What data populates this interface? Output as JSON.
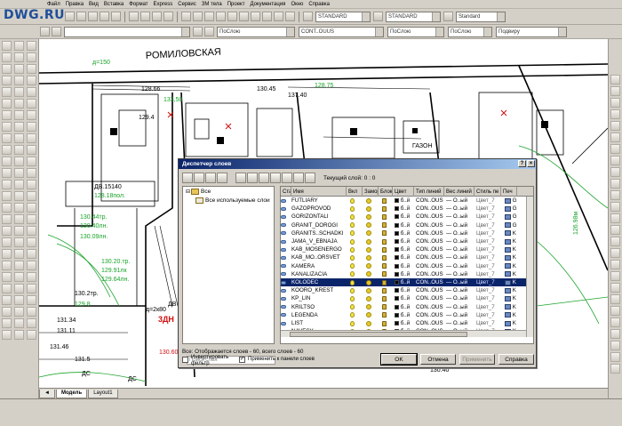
{
  "app": {
    "watermark": "DWG.RU",
    "menu": [
      "Файл",
      "Правка",
      "Вид",
      "Вставка",
      "Формат",
      "Express",
      "Сервис",
      "ЗМ тела",
      "Проект",
      "Документация",
      "Окно",
      "Справка"
    ],
    "toolbar": {
      "style1": "STANDARD",
      "style2": "STANDARD",
      "style3": "Standard",
      "layer_combo": "",
      "color_combo": "ПоСлою",
      "linetype_combo": "CONT..OUUS",
      "lineweight_combo": "ПоСлою",
      "plotstyle_combo": "ПоСлою",
      "plot_combo": "Подвиру"
    },
    "tabs": [
      "Модель",
      "Layout1"
    ],
    "tab_nav": "◄"
  },
  "drawing": {
    "street_label": "РОМИЛОВСКАЯ",
    "labels": [
      "д=150",
      "128.66",
      "133,50",
      "129.4",
      "130.45",
      "137.40",
      "128.75",
      "3ДН",
      "ДВ.15140",
      "128.18пол.",
      "130.44тр.",
      "130.40лн.",
      "130.09лн.",
      "130.20.тр.",
      "129.91лк",
      "129.64лн.",
      "130.2тр.",
      "129.8",
      "131.34",
      "131.11",
      "130.60",
      "д=2к80",
      "ДВ",
      "129.40",
      "130.20",
      "129.80",
      "ГАЗОН",
      "131.46",
      "131.5",
      "ДС",
      "ДС",
      "130.40",
      "137.10",
      "126.98м"
    ]
  },
  "dialog": {
    "title": "Диспетчер слоев",
    "current_layer": "Текущий слой: 0 : 0",
    "tree": {
      "root": "Все",
      "child": "Все используемые слои",
      "search_placeholder": "Поиск слоя"
    },
    "columns": [
      "Ста",
      "Имя",
      "Вкл",
      "Замор",
      "Блок",
      "Цвет",
      "Тип линий",
      "Вес линий",
      "Стиль пе",
      "Печ"
    ],
    "rows": [
      {
        "name": "FUTLIARY",
        "color": "б..й",
        "linetype": "CON..OUS",
        "lw": "— О..ый",
        "style": "Цвет_7",
        "sel": false
      },
      {
        "name": "GAZOPROVOD",
        "color": "б..й",
        "linetype": "CON..OUS",
        "lw": "— О..ый",
        "style": "Цвет_7",
        "sel": false
      },
      {
        "name": "GORIZONTALI",
        "color": "б..й",
        "linetype": "CON..OUS",
        "lw": "— О..ый",
        "style": "Цвет_7",
        "sel": false
      },
      {
        "name": "GRANIT_DOROGI",
        "color": "б..й",
        "linetype": "CON..OUS",
        "lw": "— О..ый",
        "style": "Цвет_7",
        "sel": false
      },
      {
        "name": "GRANITS..SCHADKI",
        "color": "б..й",
        "linetype": "CON..OUS",
        "lw": "— О..ый",
        "style": "Цвет_7",
        "sel": false
      },
      {
        "name": "JAMA_V_EBNAJA",
        "color": "б..й",
        "linetype": "CON..OUS",
        "lw": "— О..ый",
        "style": "Цвет_7",
        "sel": false
      },
      {
        "name": "KAB_MOSENERGO",
        "color": "б..й",
        "linetype": "CON..OUS",
        "lw": "— О..ый",
        "style": "Цвет_7",
        "sel": false
      },
      {
        "name": "KAB_MO..ORSVET",
        "color": "б..й",
        "linetype": "CON..OUS",
        "lw": "— О..ый",
        "style": "Цвет_7",
        "sel": false
      },
      {
        "name": "KAMERA",
        "color": "б..й",
        "linetype": "CON..OUS",
        "lw": "— О..ый",
        "style": "Цвет_7",
        "sel": false
      },
      {
        "name": "KANALIZACIA",
        "color": "б..й",
        "linetype": "CON..OUS",
        "lw": "— О..ый",
        "style": "Цвет_7",
        "sel": false
      },
      {
        "name": "KOLODEC",
        "color": "б..й",
        "linetype": "CON..OUS",
        "lw": "— О..ый",
        "style": "Цвет_7",
        "sel": true
      },
      {
        "name": "KOORO_KREST",
        "color": "б..й",
        "linetype": "CON..OUS",
        "lw": "— О..ый",
        "style": "Цвет_7",
        "sel": false
      },
      {
        "name": "KP_LIN",
        "color": "б..й",
        "linetype": "CON..OUS",
        "lw": "— О..ый",
        "style": "Цвет_7",
        "sel": false
      },
      {
        "name": "KRILTSO",
        "color": "б..й",
        "linetype": "CON..OUS",
        "lw": "— О..ый",
        "style": "Цвет_7",
        "sel": false
      },
      {
        "name": "LEGENDA",
        "color": "б..й",
        "linetype": "CON..OUS",
        "lw": "— О..ый",
        "style": "Цвет_7",
        "sel": false
      },
      {
        "name": "LIST",
        "color": "б..й",
        "linetype": "CON..OUS",
        "lw": "— О..ый",
        "style": "Цвет_7",
        "sel": false
      },
      {
        "name": "NAVESY",
        "color": "б..й",
        "linetype": "CON..OUS",
        "lw": "— О..ый",
        "style": "Цвет_7",
        "sel": false
      }
    ],
    "summary": "Все: Отображается слоев - 60, всего слоев - 60",
    "invert_filter": "Инвертировать фильтр",
    "apply_to_toolbar": "Применить к панели слоев",
    "buttons": {
      "ok": "OK",
      "cancel": "Отмена",
      "apply": "Применить",
      "help": "Справка"
    },
    "plot_letters": [
      "G",
      "G",
      "G",
      "G",
      "K",
      "K",
      "K",
      "K",
      "K",
      "K",
      "K",
      "K",
      "K",
      "K",
      "K",
      "K",
      "K"
    ]
  },
  "colors": {
    "selection": "#0a246a",
    "title_gradient_start": "#0a246a",
    "title_gradient_end": "#a6caf0",
    "drawing_green": "#1aa32a",
    "drawing_red": "#d01010"
  }
}
